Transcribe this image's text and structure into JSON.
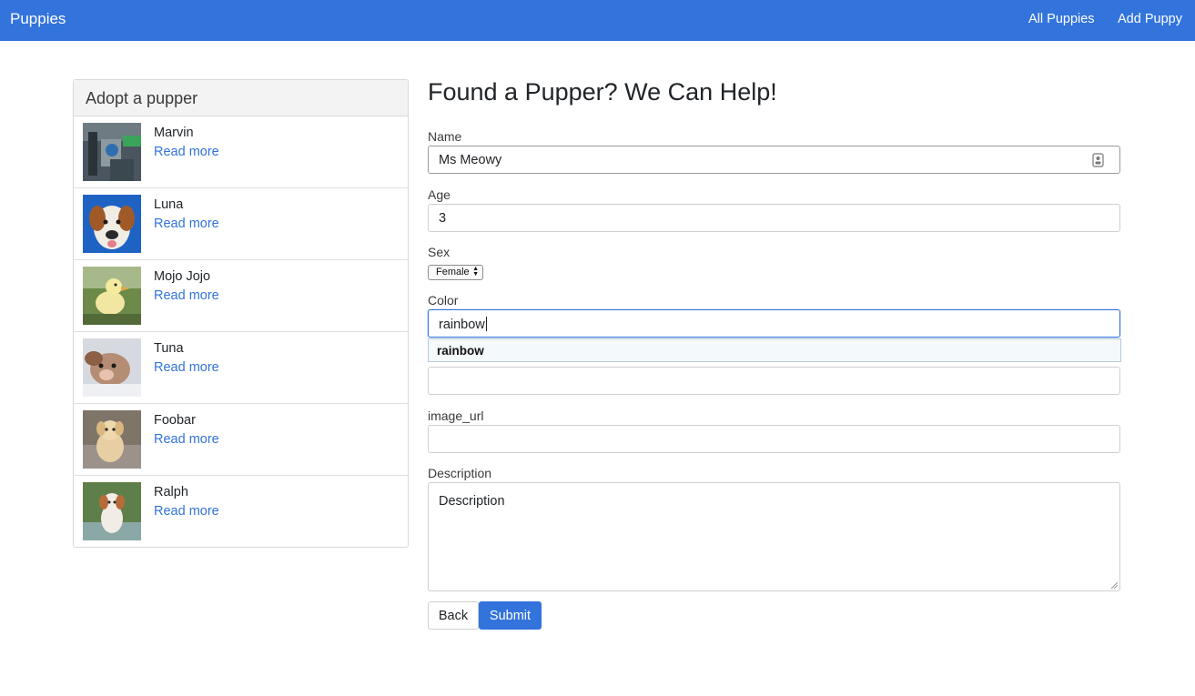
{
  "navbar": {
    "brand": "Puppies",
    "links": [
      "All Puppies",
      "Add Puppy"
    ],
    "color": "#3273dc"
  },
  "sidebar": {
    "title": "Adopt a pupper",
    "puppies": [
      {
        "name": "Marvin",
        "link": "Read more",
        "thumb": "marvin-photo"
      },
      {
        "name": "Luna",
        "link": "Read more",
        "thumb": "luna-photo"
      },
      {
        "name": "Mojo Jojo",
        "link": "Read more",
        "thumb": "duckling-photo"
      },
      {
        "name": "Tuna",
        "link": "Read more",
        "thumb": "tuna-photo"
      },
      {
        "name": "Foobar",
        "link": "Read more",
        "thumb": "foobar-photo"
      },
      {
        "name": "Ralph",
        "link": "Read more",
        "thumb": "ralph-photo"
      }
    ]
  },
  "form": {
    "title": "Found a Pupper? We Can Help!",
    "name_label": "Name",
    "name_value": "Ms Meowy",
    "age_label": "Age",
    "age_value": "3",
    "sex_label": "Sex",
    "sex_value": "Female",
    "color_label": "Color",
    "color_value": "rainbow",
    "color_suggestion": "rainbow",
    "breed_value": "",
    "image_url_label": "image_url",
    "image_url_value": "",
    "description_label": "Description",
    "description_placeholder": "Description",
    "back_label": "Back",
    "submit_label": "Submit"
  }
}
